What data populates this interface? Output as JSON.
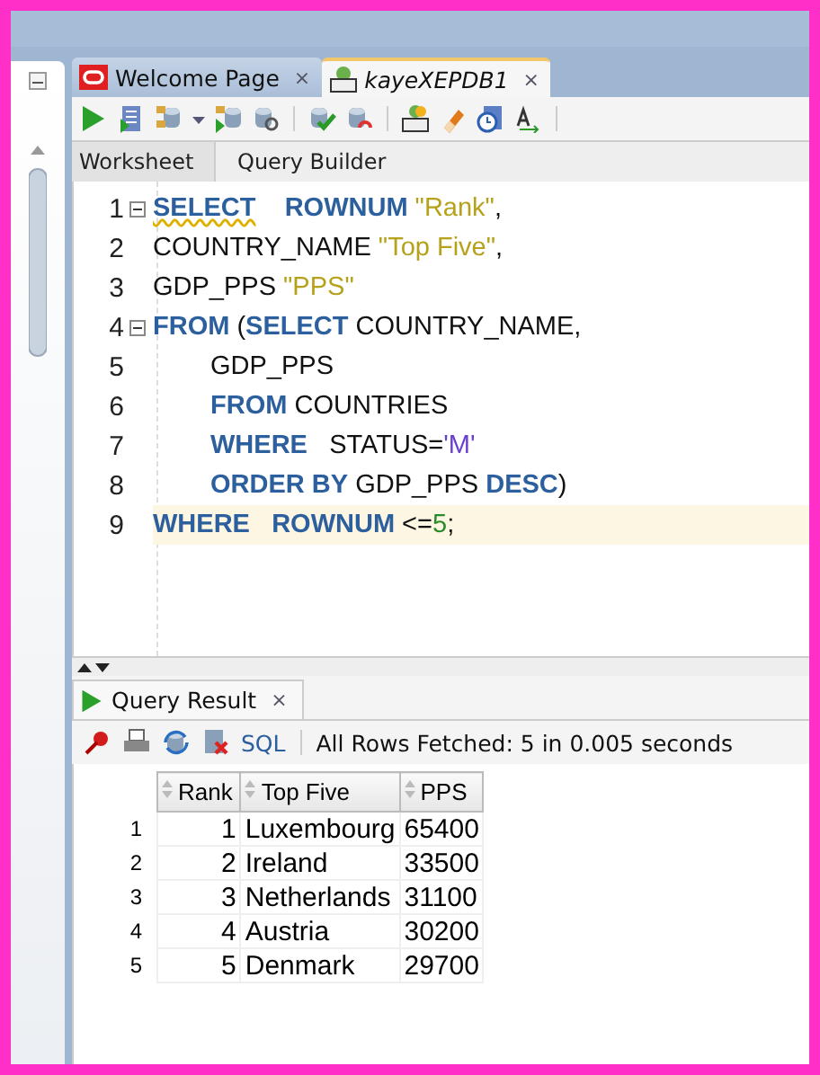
{
  "document_tabs": [
    {
      "label": "Welcome Page",
      "close": "×",
      "selected": false,
      "kind": "welcome"
    },
    {
      "label": "kayeXEPDB1",
      "close": "×",
      "selected": true,
      "kind": "sql"
    }
  ],
  "editor_tabs": [
    {
      "label": "Worksheet",
      "selected": true
    },
    {
      "label": "Query Builder",
      "selected": false
    }
  ],
  "editor": {
    "lines": [
      {
        "number": "1",
        "fold": true,
        "current": false,
        "indented": false,
        "tokens": [
          {
            "kind": "keyword",
            "text": "SELECT",
            "warning": true
          },
          {
            "kind": "keyword",
            "text": "    ROWNUM",
            "warning": false
          },
          {
            "kind": "string",
            "text": " \"Rank\"",
            "warning": false
          },
          {
            "kind": "plain",
            "text": ",",
            "warning": false
          }
        ]
      },
      {
        "number": "2",
        "fold": false,
        "current": false,
        "indented": false,
        "tokens": [
          {
            "kind": "plain",
            "text": "COUNTRY_NAME",
            "warning": false
          },
          {
            "kind": "string",
            "text": " \"Top Five\"",
            "warning": false
          },
          {
            "kind": "plain",
            "text": ",",
            "warning": false
          }
        ]
      },
      {
        "number": "3",
        "fold": false,
        "current": false,
        "indented": false,
        "tokens": [
          {
            "kind": "plain",
            "text": "GDP_PPS",
            "warning": false
          },
          {
            "kind": "string",
            "text": " \"PPS\"",
            "warning": false
          }
        ]
      },
      {
        "number": "4",
        "fold": true,
        "current": false,
        "indented": false,
        "tokens": [
          {
            "kind": "keyword",
            "text": "FROM",
            "warning": false
          },
          {
            "kind": "plain",
            "text": " (",
            "warning": false
          },
          {
            "kind": "keyword",
            "text": "SELECT",
            "warning": false
          },
          {
            "kind": "plain",
            "text": " COUNTRY_NAME,",
            "warning": false
          }
        ]
      },
      {
        "number": "5",
        "fold": false,
        "current": false,
        "indented": true,
        "tokens": [
          {
            "kind": "plain",
            "text": "GDP_PPS",
            "warning": false
          }
        ]
      },
      {
        "number": "6",
        "fold": false,
        "current": false,
        "indented": true,
        "tokens": [
          {
            "kind": "keyword",
            "text": "FROM",
            "warning": false
          },
          {
            "kind": "plain",
            "text": " COUNTRIES",
            "warning": false
          }
        ]
      },
      {
        "number": "7",
        "fold": false,
        "current": false,
        "indented": true,
        "tokens": [
          {
            "kind": "keyword",
            "text": "WHERE",
            "warning": false
          },
          {
            "kind": "plain",
            "text": "   STATUS=",
            "warning": false
          },
          {
            "kind": "char",
            "text": "'M'",
            "warning": false
          }
        ]
      },
      {
        "number": "8",
        "fold": false,
        "current": false,
        "indented": true,
        "tokens": [
          {
            "kind": "keyword",
            "text": "ORDER BY",
            "warning": false
          },
          {
            "kind": "plain",
            "text": " GDP_PPS ",
            "warning": false
          },
          {
            "kind": "keyword",
            "text": "DESC",
            "warning": false
          },
          {
            "kind": "plain",
            "text": ")",
            "warning": false
          }
        ]
      },
      {
        "number": "9",
        "fold": false,
        "current": true,
        "indented": false,
        "tokens": [
          {
            "kind": "keyword",
            "text": "WHERE",
            "warning": false
          },
          {
            "kind": "keyword",
            "text": "   ROWNUM",
            "warning": false
          },
          {
            "kind": "plain",
            "text": " <=",
            "warning": false
          },
          {
            "kind": "number",
            "text": "5",
            "warning": false
          },
          {
            "kind": "plain",
            "text": ";",
            "warning": false
          }
        ]
      }
    ]
  },
  "result_tab": {
    "label": "Query Result",
    "close": "×"
  },
  "result_toolbar": {
    "sql_link": "SQL",
    "status": "All Rows Fetched: 5 in 0.005 seconds"
  },
  "result_table": {
    "columns": [
      "Rank",
      "Top Five",
      "PPS"
    ],
    "rows": [
      {
        "row_number": "1",
        "cells": [
          "1",
          "Luxembourg",
          "65400"
        ]
      },
      {
        "row_number": "2",
        "cells": [
          "2",
          "Ireland",
          "33500"
        ]
      },
      {
        "row_number": "3",
        "cells": [
          "3",
          "Netherlands",
          "31100"
        ]
      },
      {
        "row_number": "4",
        "cells": [
          "4",
          "Austria",
          "30200"
        ]
      },
      {
        "row_number": "5",
        "cells": [
          "5",
          "Denmark",
          "29700"
        ]
      }
    ]
  }
}
